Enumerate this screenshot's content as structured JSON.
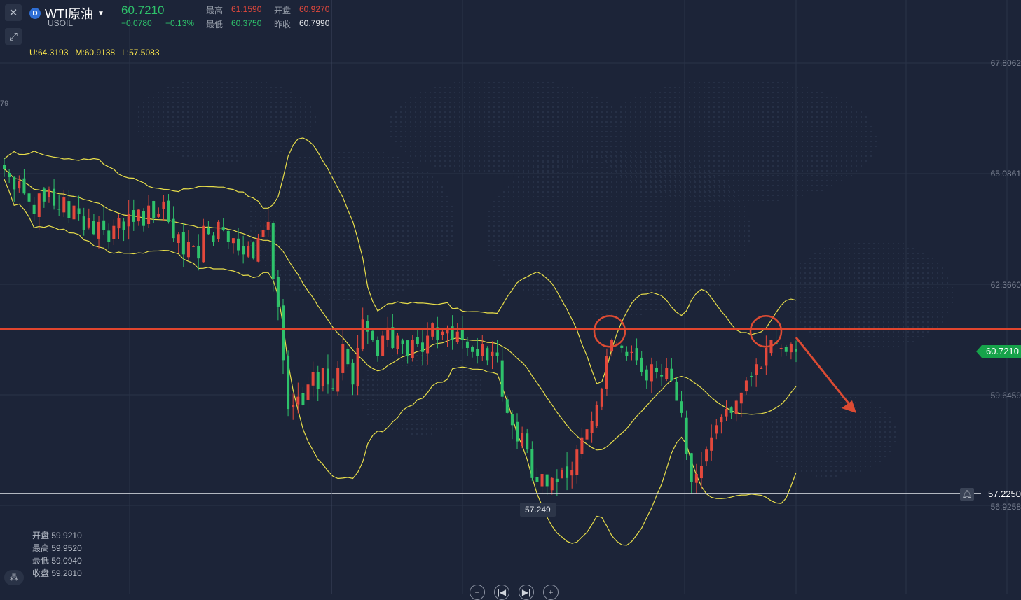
{
  "header": {
    "symbol_name": "WTI原油",
    "symbol_code": "USOIL",
    "symbol_badge": "D",
    "last_price": "60.7210",
    "change": "−0.0780",
    "change_pct": "−0.13%",
    "high_label": "最高",
    "high_value": "61.1590",
    "open_label": "开盘",
    "open_value": "60.9270",
    "low_label": "最低",
    "low_value": "60.3750",
    "prev_close_label": "昨收",
    "prev_close_value": "60.7990"
  },
  "indicator": {
    "upper": "U:64.3193",
    "middle": "M:60.9138",
    "lower": "L:57.5083"
  },
  "left_axis_fragment": "79",
  "bottom_info": {
    "open_label": "开盘",
    "open_value": "59.9210",
    "high_label": "最高",
    "high_value": "59.9520",
    "low_label": "最低",
    "low_value": "59.0940",
    "close_label": "收盘",
    "close_value": "59.2810"
  },
  "colors": {
    "background": "#1c2438",
    "up": "#e3483c",
    "down": "#2ec26b",
    "band": "#e8de4a",
    "resistance": "#e0452e",
    "annotation": "#dc4b33",
    "last_price": "#16a34a"
  },
  "icons": {
    "close": "close-icon",
    "fullscreen": "expand-arrows-icon",
    "alert": "bell-icon",
    "indicator_toggle": "indicator-icon"
  },
  "nav_buttons": [
    "−",
    "|◀",
    "▶|",
    "+"
  ],
  "chart_data": {
    "type": "candlestick",
    "symbol": "USOIL",
    "y_ticks": [
      "67.8062",
      "65.0861",
      "62.3660",
      "59.6459",
      "56.9258"
    ],
    "ylim": [
      56.5,
      68.5
    ],
    "last_price_label": "60.7210",
    "last_price": 60.721,
    "alert_level_label": "57.2250",
    "alert_level": 57.225,
    "low_marker_label": "57.249",
    "low_marker": 57.249,
    "resistance_level": 61.26,
    "grid": true,
    "bollinger": {
      "upper": 64.3193,
      "middle": 60.9138,
      "lower": 57.5083
    },
    "annotations": [
      "two circles at resistance touches",
      "downward arrow at right edge"
    ],
    "candles_close": [
      65.2,
      65.0,
      64.7,
      64.9,
      64.6,
      64.4,
      64.1,
      64.6,
      64.4,
      64.7,
      64.3,
      64.2,
      64.5,
      64.0,
      64.3,
      64.1,
      63.7,
      64.0,
      63.6,
      63.9,
      63.7,
      63.4,
      63.8,
      64.0,
      63.7,
      64.1,
      63.9,
      64.2,
      63.8,
      64.3,
      64.0,
      64.1,
      64.4,
      63.9,
      63.5,
      63.6,
      63.1,
      63.4,
      63.3,
      63.0,
      63.8,
      63.6,
      63.4,
      63.9,
      63.7,
      63.4,
      63.5,
      63.2,
      63.1,
      63.3,
      63.0,
      63.5,
      63.7,
      63.9,
      62.5,
      61.8,
      60.5,
      59.3,
      59.4,
      59.6,
      59.4,
      59.9,
      60.2,
      59.8,
      60.3,
      59.9,
      59.8,
      60.3,
      60.9,
      60.4,
      59.9,
      60.8,
      61.5,
      61.2,
      61.0,
      60.6,
      61.1,
      61.3,
      60.8,
      61.1,
      60.9,
      60.6,
      61.0,
      60.9,
      60.7,
      61.1,
      61.4,
      61.0,
      61.2,
      61.3,
      61.0,
      61.2,
      61.0,
      60.8,
      60.7,
      60.6,
      60.9,
      60.5,
      60.7,
      60.6,
      59.6,
      59.2,
      58.9,
      58.5,
      58.7,
      58.3,
      57.6,
      57.5,
      57.7,
      57.4,
      57.6,
      57.5,
      57.8,
      57.6,
      57.8,
      58.3,
      58.6,
      58.8,
      59.0,
      59.4,
      59.8,
      60.6,
      61.0,
      60.9,
      60.8,
      60.6,
      60.7,
      60.5,
      60.2,
      60.0,
      60.4,
      60.2,
      60.1,
      60.3,
      60.0,
      59.5,
      59.2,
      58.2,
      57.5,
      57.7,
      57.9,
      58.3,
      58.6,
      58.9,
      59.1,
      59.3,
      59.2,
      59.5,
      59.7,
      60.0,
      60.1,
      60.4,
      60.3,
      60.8,
      61.0,
      60.9,
      60.8,
      60.7,
      60.9,
      60.7
    ]
  }
}
